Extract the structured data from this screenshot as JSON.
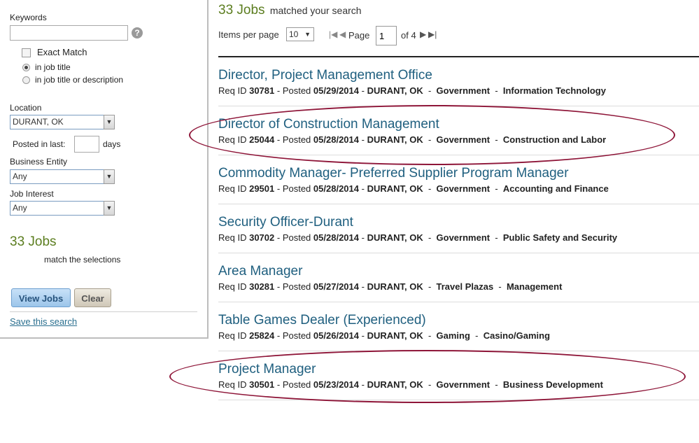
{
  "sidebar": {
    "keywords_label": "Keywords",
    "keywords_value": "",
    "help_glyph": "?",
    "exact_match_label": "Exact Match",
    "radio_job_title": "in job title",
    "radio_title_desc": "in job title or description",
    "location_label": "Location",
    "location_value": "DURANT, OK",
    "posted_label": "Posted in last:",
    "posted_value": "",
    "days_label": "days",
    "entity_label": "Business Entity",
    "entity_value": "Any",
    "interest_label": "Job Interest",
    "interest_value": "Any",
    "count": "33 Jobs",
    "count_sub": "match the selections",
    "view_button": "View Jobs",
    "clear_button": "Clear",
    "save_link": "Save this search"
  },
  "results": {
    "count": "33 Jobs",
    "count_sub": "matched your search",
    "items_per_page_label": "Items per page",
    "items_per_page_value": "10",
    "page_label": "Page",
    "page_value": "1",
    "of_label": "of 4",
    "jobs": [
      {
        "title": "Director, Project Management Office",
        "req_label": "Req ID",
        "req_id": "30781",
        "posted_label": "Posted",
        "posted": "05/29/2014",
        "location": "DURANT, OK",
        "entity": "Government",
        "category": "Information Technology"
      },
      {
        "title": "Director of Construction Management",
        "req_label": "Req ID",
        "req_id": "25044",
        "posted_label": "Posted",
        "posted": "05/28/2014",
        "location": "DURANT, OK",
        "entity": "Government",
        "category": "Construction and Labor"
      },
      {
        "title": "Commodity Manager- Preferred Supplier Program Manager",
        "req_label": "Req ID",
        "req_id": "29501",
        "posted_label": "Posted",
        "posted": "05/28/2014",
        "location": "DURANT, OK",
        "entity": "Government",
        "category": "Accounting and Finance"
      },
      {
        "title": "Security Officer-Durant",
        "req_label": "Req ID",
        "req_id": "30702",
        "posted_label": "Posted",
        "posted": "05/28/2014",
        "location": "DURANT, OK",
        "entity": "Government",
        "category": "Public Safety and Security"
      },
      {
        "title": "Area Manager",
        "req_label": "Req ID",
        "req_id": "30281",
        "posted_label": "Posted",
        "posted": "05/27/2014",
        "location": "DURANT, OK",
        "entity": "Travel Plazas",
        "category": "Management"
      },
      {
        "title": "Table Games Dealer (Experienced)",
        "req_label": "Req ID",
        "req_id": "25824",
        "posted_label": "Posted",
        "posted": "05/26/2014",
        "location": "DURANT, OK",
        "entity": "Gaming",
        "category": "Casino/Gaming"
      },
      {
        "title": "Project Manager",
        "req_label": "Req ID",
        "req_id": "30501",
        "posted_label": "Posted",
        "posted": "05/23/2014",
        "location": "DURANT, OK",
        "entity": "Government",
        "category": "Business Development"
      }
    ]
  },
  "colors": {
    "count_green": "#5b7d1f",
    "title_blue": "#1f5f7f",
    "annotation_red": "#8e1538"
  },
  "icons": [
    "help-icon",
    "first-page-icon",
    "prev-page-icon",
    "next-page-icon",
    "last-page-icon",
    "dropdown-arrow-icon"
  ]
}
